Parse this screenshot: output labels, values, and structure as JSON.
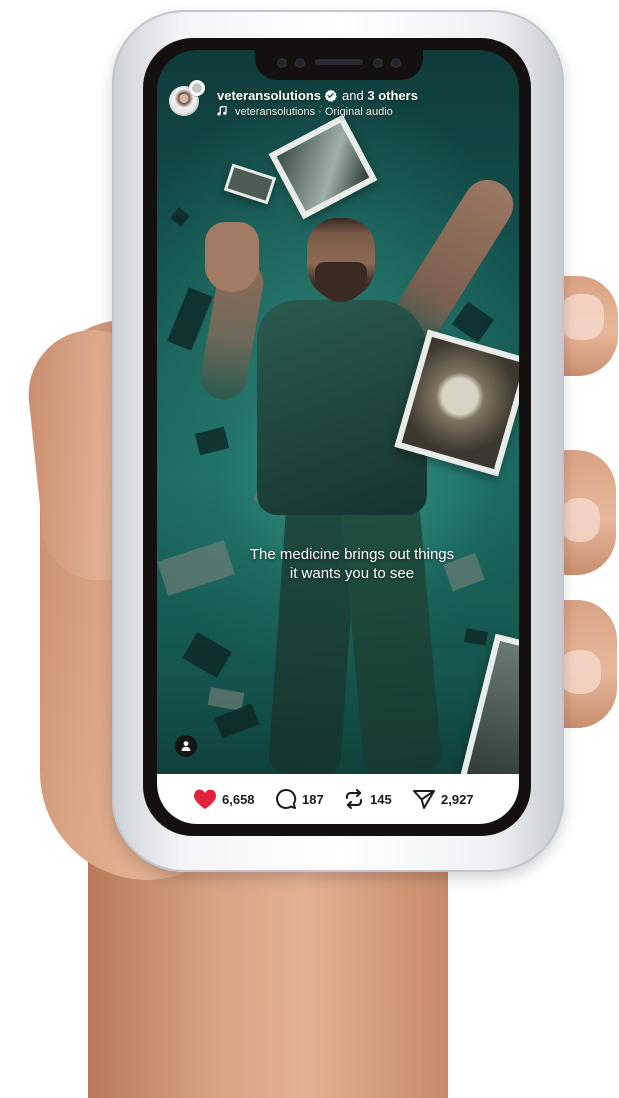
{
  "post": {
    "author": "veteransolutions",
    "collab_text": "and",
    "collab_count": "3 others",
    "audio": "veteransolutions · Original audio",
    "caption_lines": [
      "The medicine brings out things",
      "it wants you to see"
    ]
  },
  "actions": {
    "likes": "6,658",
    "comments": "187",
    "reposts": "145",
    "shares": "2,927"
  },
  "colors": {
    "like_red": "#e0243c",
    "screen_teal": "#1a6a60",
    "icon_dark": "#1b1b1b"
  },
  "icons": [
    "verified-icon",
    "music-icon",
    "heart-icon",
    "comment-icon",
    "repost-icon",
    "share-icon",
    "profile-icon"
  ]
}
